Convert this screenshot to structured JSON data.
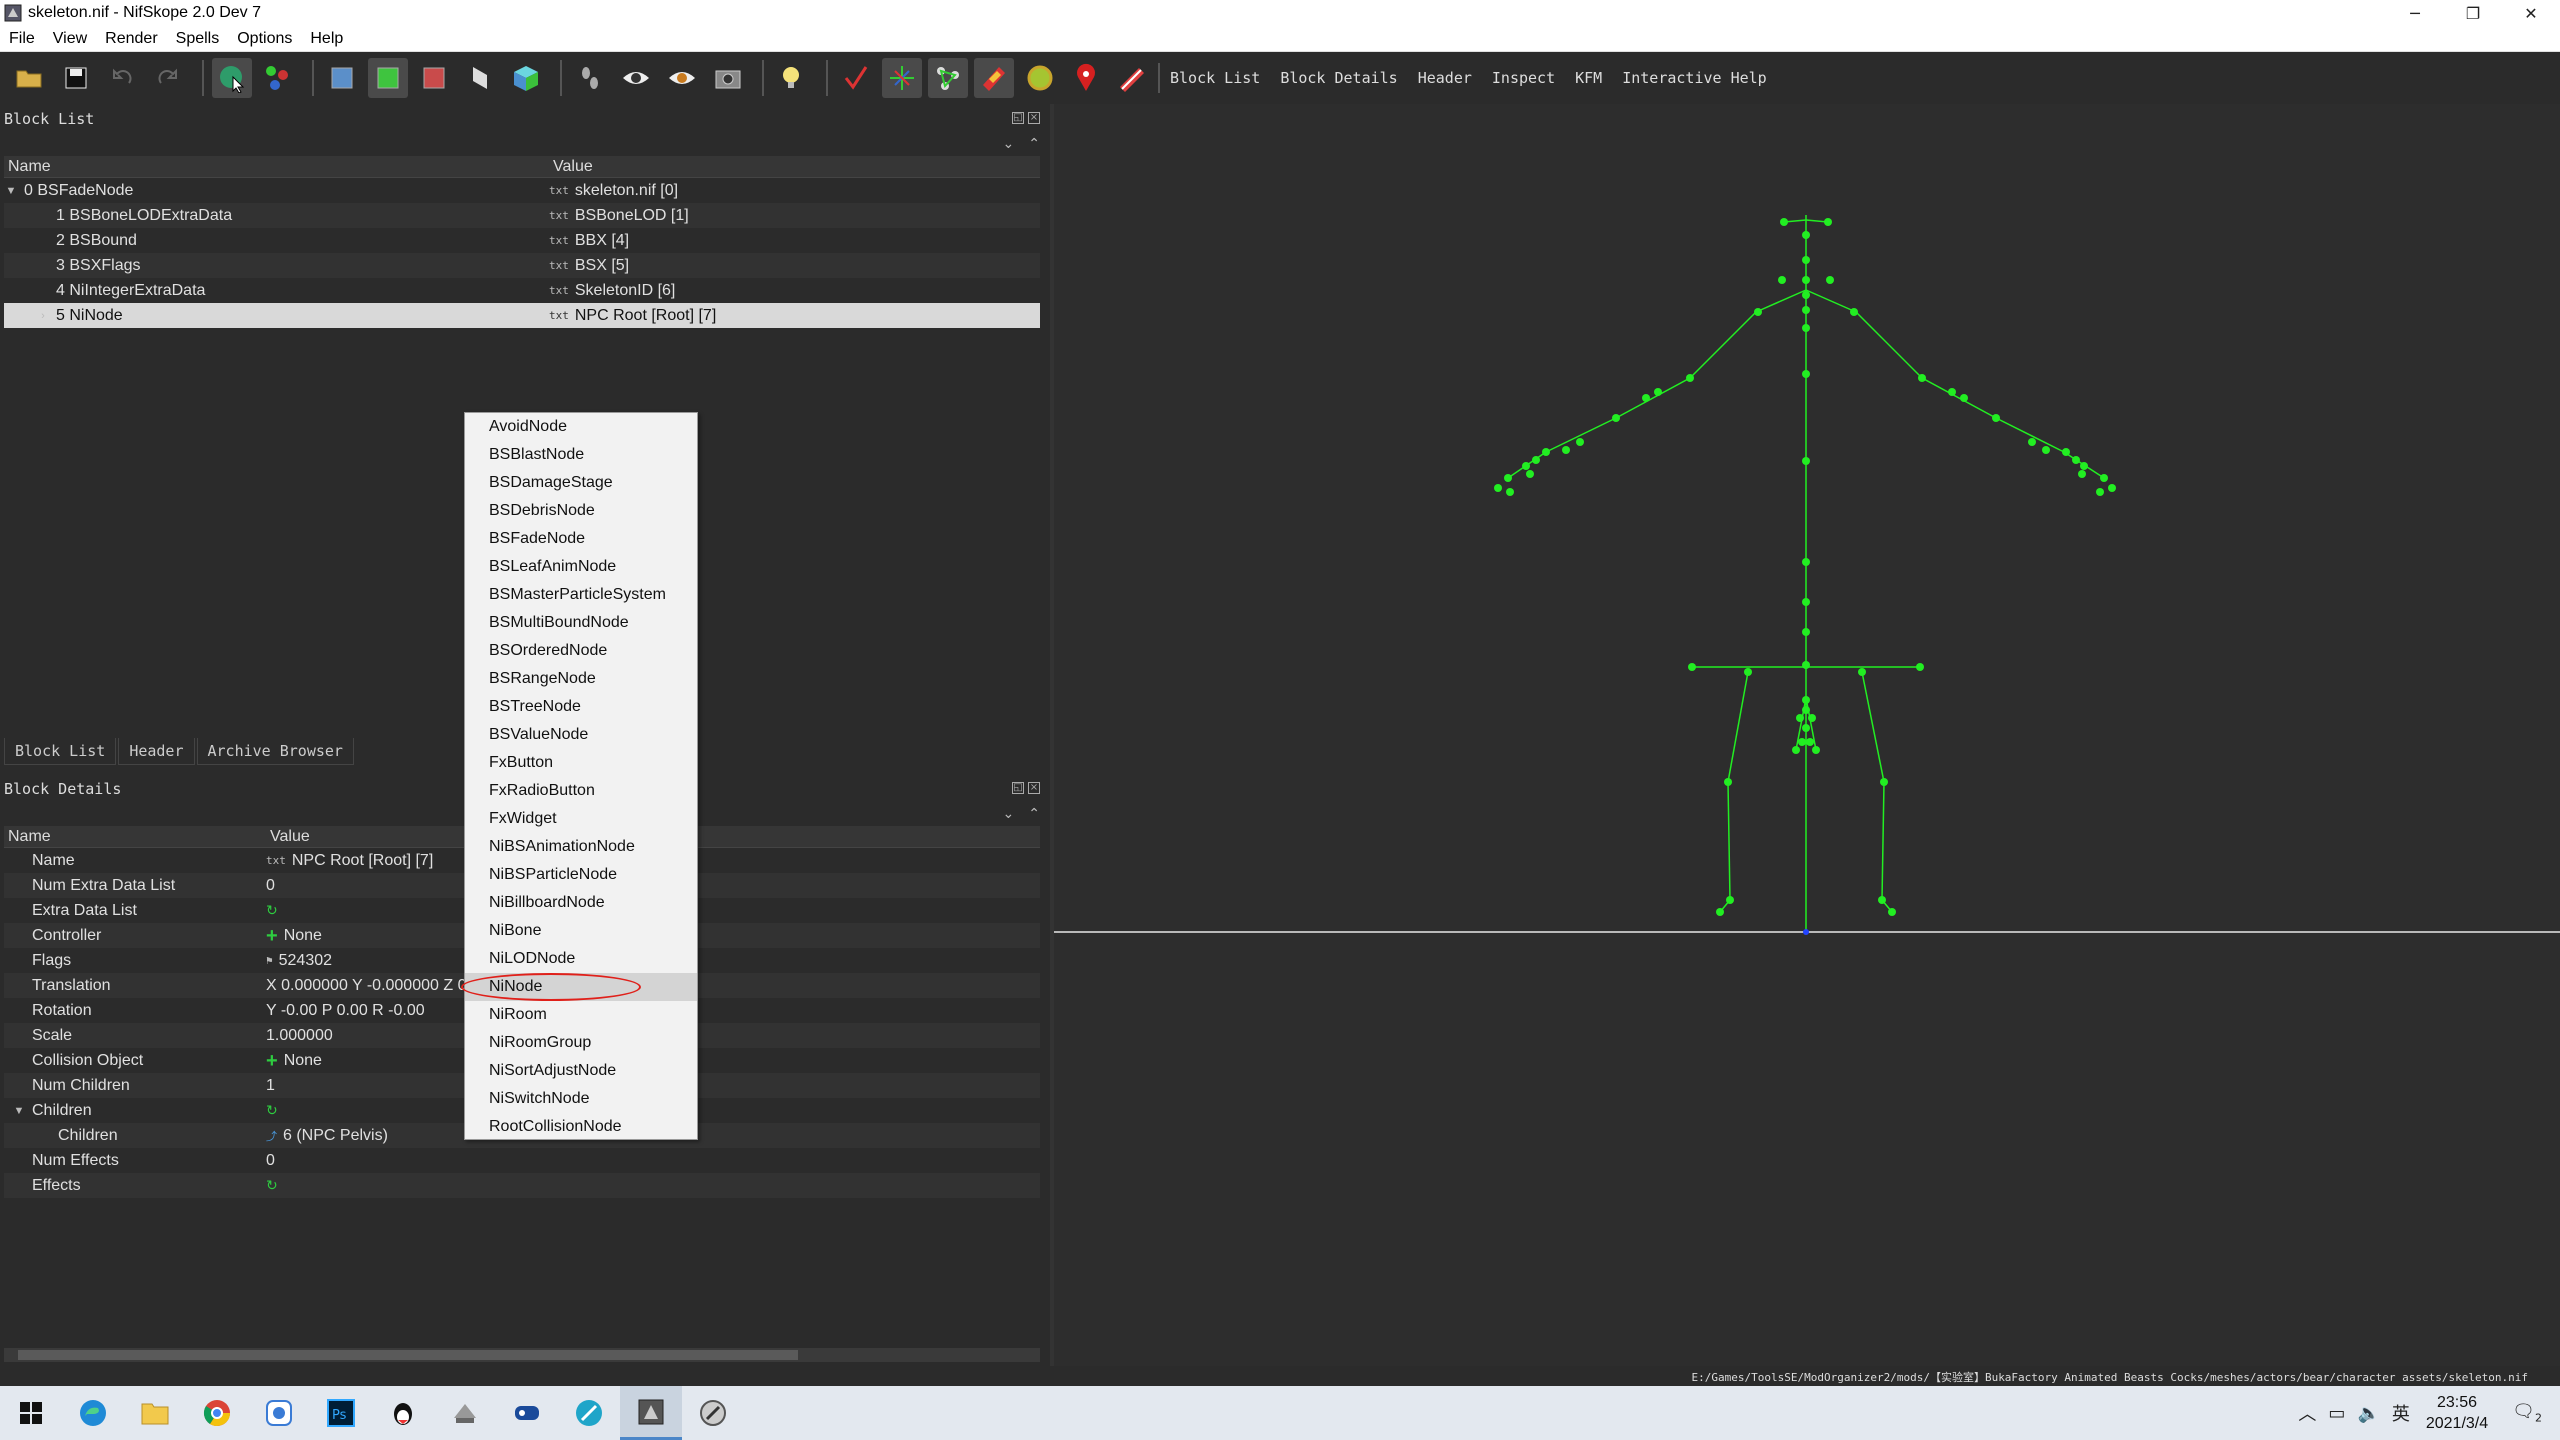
{
  "window": {
    "title": "skeleton.nif - NifSkope 2.0 Dev 7",
    "minimize": "─",
    "restore": "❐",
    "close": "✕"
  },
  "menu": [
    "File",
    "View",
    "Render",
    "Spells",
    "Options",
    "Help"
  ],
  "toolbar": {
    "text_buttons": [
      "Block List",
      "Block Details",
      "Header",
      "Inspect",
      "KFM",
      "Interactive Help"
    ]
  },
  "block_list": {
    "title": "Block List",
    "columns": [
      "Name",
      "Value"
    ],
    "rows": [
      {
        "name": "0 BSFadeNode",
        "value": "skeleton.nif [0]"
      },
      {
        "name": "1 BSBoneLODExtraData",
        "value": "BSBoneLOD [1]"
      },
      {
        "name": "2 BSBound",
        "value": "BBX [4]"
      },
      {
        "name": "3 BSXFlags",
        "value": "BSX [5]"
      },
      {
        "name": "4 NiIntegerExtraData",
        "value": "SkeletonID [6]"
      },
      {
        "name": "5 NiNode",
        "value": "NPC Root [Root] [7]"
      }
    ],
    "txt_icon": "txt"
  },
  "bottom_tabs": [
    "Block List",
    "Header",
    "Archive Browser"
  ],
  "block_details": {
    "title": "Block Details",
    "columns": [
      "Name",
      "Value"
    ],
    "rows": [
      {
        "name": "Name",
        "value": "NPC Root [Root] [7]"
      },
      {
        "name": "Num Extra Data List",
        "value": "0"
      },
      {
        "name": "Extra Data List",
        "value": ""
      },
      {
        "name": "Controller",
        "value": "None"
      },
      {
        "name": "Flags",
        "value": "524302"
      },
      {
        "name": "Translation",
        "value": "X 0.000000 Y -0.000000 Z 0"
      },
      {
        "name": "Rotation",
        "value": "Y -0.00 P 0.00 R -0.00"
      },
      {
        "name": "Scale",
        "value": "1.000000"
      },
      {
        "name": "Collision Object",
        "value": "None"
      },
      {
        "name": "Num Children",
        "value": "1"
      },
      {
        "name": "Children",
        "value": ""
      },
      {
        "name": "Children",
        "value": "6 (NPC Pelvis)"
      },
      {
        "name": "Num Effects",
        "value": "0"
      },
      {
        "name": "Effects",
        "value": ""
      }
    ]
  },
  "popup_menu": {
    "items": [
      "AvoidNode",
      "BSBlastNode",
      "BSDamageStage",
      "BSDebrisNode",
      "BSFadeNode",
      "BSLeafAnimNode",
      "BSMasterParticleSystem",
      "BSMultiBoundNode",
      "BSOrderedNode",
      "BSRangeNode",
      "BSTreeNode",
      "BSValueNode",
      "FxButton",
      "FxRadioButton",
      "FxWidget",
      "NiBSAnimationNode",
      "NiBSParticleNode",
      "NiBillboardNode",
      "NiBone",
      "NiLODNode",
      "NiNode",
      "NiRoom",
      "NiRoomGroup",
      "NiSortAdjustNode",
      "NiSwitchNode",
      "RootCollisionNode"
    ],
    "highlighted": "NiNode"
  },
  "status": {
    "path": "E:/Games/ToolsSE/ModOrganizer2/mods/【实验室】BukaFactory Animated Beasts Cocks/meshes/actors/bear/character assets/skeleton.nif"
  },
  "taskbar": {
    "time": "23:56",
    "date": "2021/3/4",
    "ime": "英",
    "notifications": "2"
  },
  "colors": {
    "skeleton": "#22ee22",
    "ground": "#e8e8e8",
    "annotation": "#e0201a"
  }
}
